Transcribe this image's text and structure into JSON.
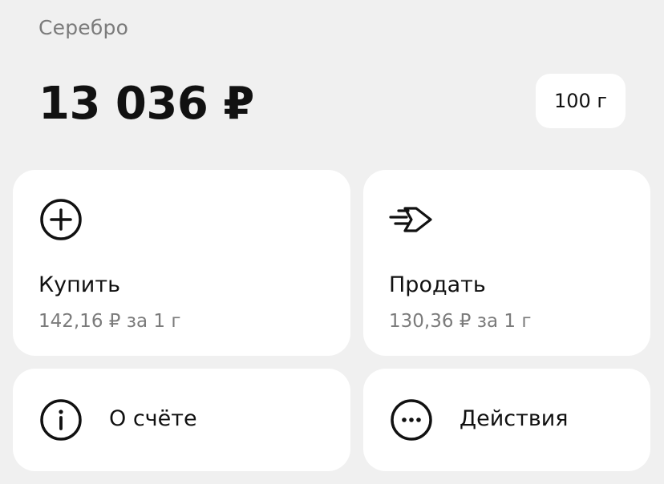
{
  "header": {
    "metal_name": "Серебро",
    "balance": "13 036 ₽",
    "weight": "100 г"
  },
  "cards": {
    "buy": {
      "icon": "plus-circle-icon",
      "title": "Купить",
      "subtitle": "142,16 ₽ за 1 г"
    },
    "sell": {
      "icon": "fast-arrow-right-icon",
      "title": "Продать",
      "subtitle": "130,36 ₽ за 1 г"
    },
    "info": {
      "icon": "info-circle-icon",
      "label": "О счёте"
    },
    "actions": {
      "icon": "more-dots-icon",
      "label": "Действия"
    }
  },
  "colors": {
    "background": "#f0f0f0",
    "card": "#ffffff",
    "primary_text": "#111111",
    "secondary_text": "#7b7b7b"
  }
}
